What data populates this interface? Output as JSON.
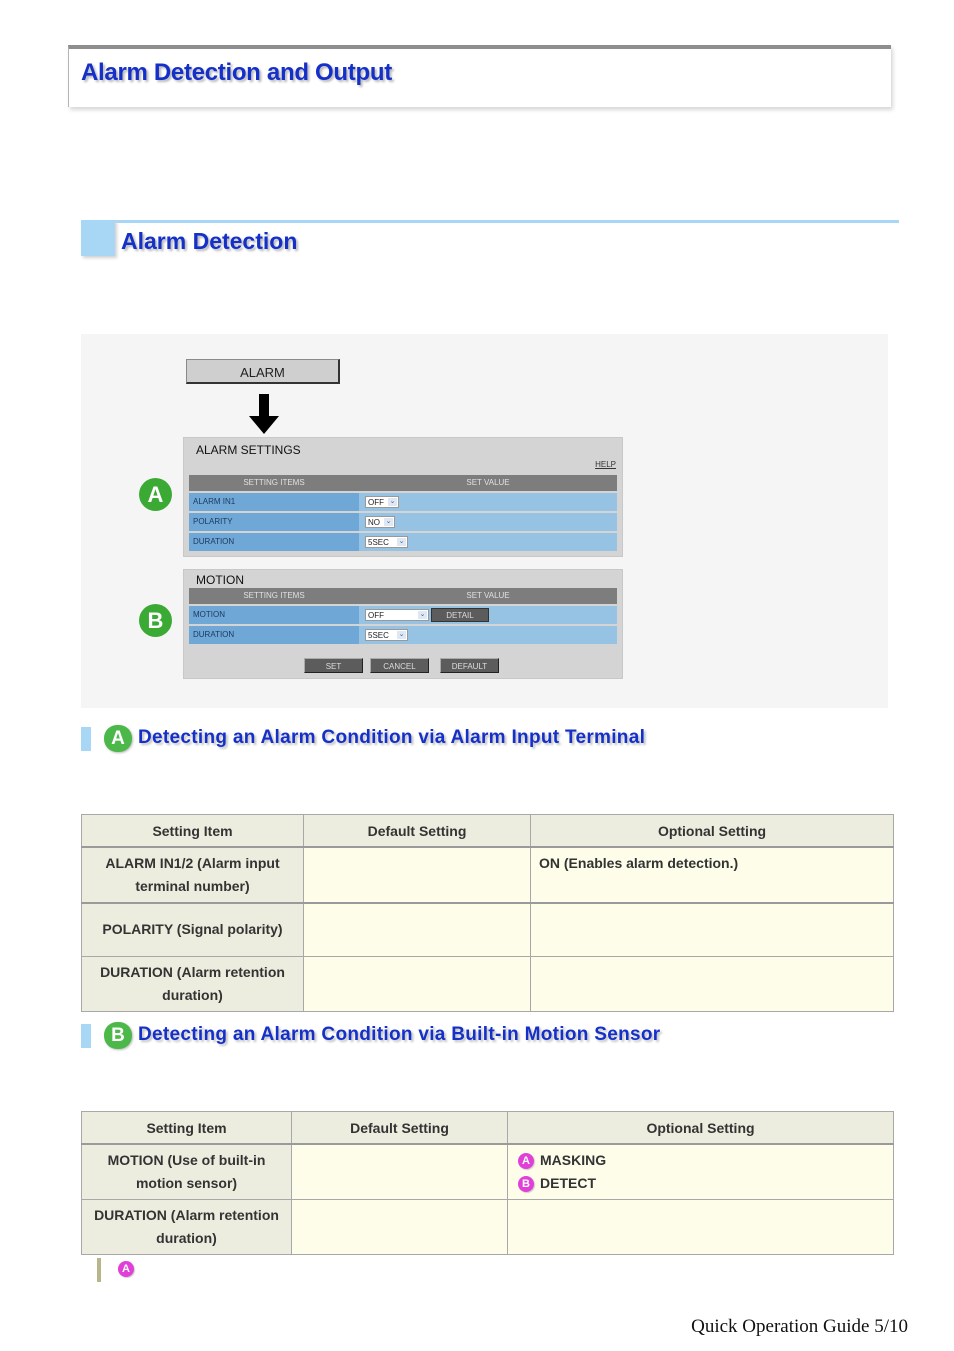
{
  "page_title": "Alarm Detection and Output",
  "section_title": "Alarm Detection",
  "screenshot": {
    "alarm_button": "ALARM",
    "alarm_settings": {
      "title": "ALARM SETTINGS",
      "help_link": "HELP",
      "col_items": "SETTING ITEMS",
      "col_value": "SET VALUE",
      "rows": [
        {
          "label": "ALARM IN1",
          "value": "OFF"
        },
        {
          "label": "POLARITY",
          "value": "NO"
        },
        {
          "label": "DURATION",
          "value": "5SEC"
        }
      ]
    },
    "motion": {
      "title": "MOTION",
      "col_items": "SETTING ITEMS",
      "col_value": "SET VALUE",
      "rows": [
        {
          "label": "MOTION",
          "value": "OFF",
          "button": "DETAIL"
        },
        {
          "label": "DURATION",
          "value": "5SEC"
        }
      ],
      "buttons": {
        "set": "SET",
        "cancel": "CANCEL",
        "default": "DEFAULT"
      }
    },
    "markers": {
      "a": "A",
      "b": "B"
    }
  },
  "subsection_a": {
    "badge": "A",
    "title": "Detecting an Alarm Condition via Alarm Input Terminal",
    "table": {
      "headers": [
        "Setting Item",
        "Default Setting",
        "Optional Setting"
      ],
      "rows": [
        {
          "item": "ALARM IN1/2 (Alarm input terminal number)",
          "default": "",
          "optional": "ON (Enables alarm detection.)"
        },
        {
          "item": "POLARITY (Signal polarity)",
          "default": "",
          "optional": ""
        },
        {
          "item": "DURATION (Alarm retention duration)",
          "default": "",
          "optional": ""
        }
      ]
    }
  },
  "subsection_b": {
    "badge": "B",
    "title": "Detecting an Alarm Condition via Built-in Motion Sensor",
    "table": {
      "headers": [
        "Setting Item",
        "Default Setting",
        "Optional Setting"
      ],
      "rows": [
        {
          "item": "MOTION (Use of built-in motion sensor)",
          "default": "",
          "optional_items": [
            {
              "badge": "A",
              "label": "MASKING"
            },
            {
              "badge": "B",
              "label": "DETECT"
            }
          ]
        },
        {
          "item": "DURATION (Alarm retention duration)",
          "default": "",
          "optional": ""
        }
      ]
    }
  },
  "note": {
    "badge": "A"
  },
  "footer": "Quick Operation Guide 5/10"
}
